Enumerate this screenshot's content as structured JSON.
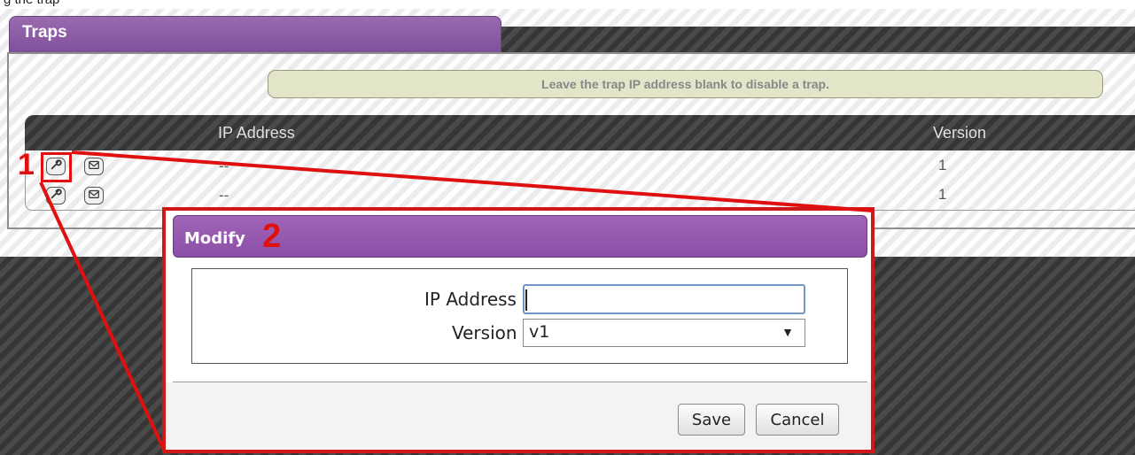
{
  "caption": "g the trap",
  "traps": {
    "title": "Traps",
    "info": "Leave the trap IP address blank to disable a trap.",
    "columns": {
      "ip": "IP Address",
      "version": "Version"
    },
    "rows": [
      {
        "ip": "--",
        "version": "1"
      },
      {
        "ip": "--",
        "version": "1"
      }
    ],
    "icons": {
      "modify": "wrench-icon",
      "test": "mail-icon"
    }
  },
  "annotations": {
    "step1": "1",
    "step2": "2",
    "color": "#e01010"
  },
  "modify_dialog": {
    "title": "Modify",
    "ip_label": "IP Address",
    "ip_value": "",
    "version_label": "Version",
    "version_value": "v1",
    "save": "Save",
    "cancel": "Cancel"
  },
  "colors": {
    "header_purple": "#8c4fa6",
    "info_bg": "#e3e5c9"
  }
}
